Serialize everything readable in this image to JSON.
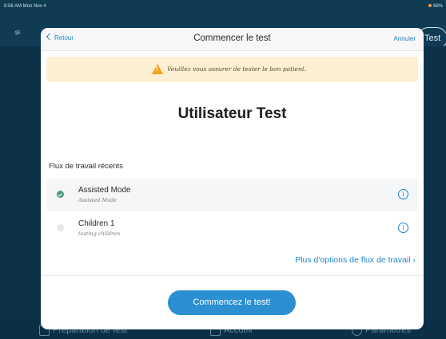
{
  "status_bar": {
    "time": "8:56 AM  Mon Nov 4",
    "battery": "68%"
  },
  "background": {
    "test_button": "Test"
  },
  "tab_bar": {
    "items": [
      {
        "label": "Préparation de test",
        "icon": "clipboard-icon"
      },
      {
        "label": "Accueil",
        "icon": "home-icon"
      },
      {
        "label": "Paramètres",
        "icon": "gear-icon"
      }
    ]
  },
  "modal": {
    "back_label": "Retour",
    "title": "Commencer le test",
    "cancel_label": "Annuler",
    "warning": "Veuillez vous assurer de tester le bon patient.",
    "user_name": "Utilisateur Test",
    "section_title": "Flux de travail récents",
    "workflows": [
      {
        "title": "Assisted Mode",
        "subtitle": "Assisted Mode",
        "selected": true
      },
      {
        "title": "Children 1",
        "subtitle": "testing children",
        "selected": false
      }
    ],
    "more_options": "Plus d'options de flux de travail ›",
    "start_button": "Commencez le test!"
  },
  "colors": {
    "accent": "#1f86c8",
    "button": "#2b8fd1",
    "warning_bg": "#fcefd2",
    "selected": "#4b9a7a",
    "background": "#0e3a52"
  }
}
